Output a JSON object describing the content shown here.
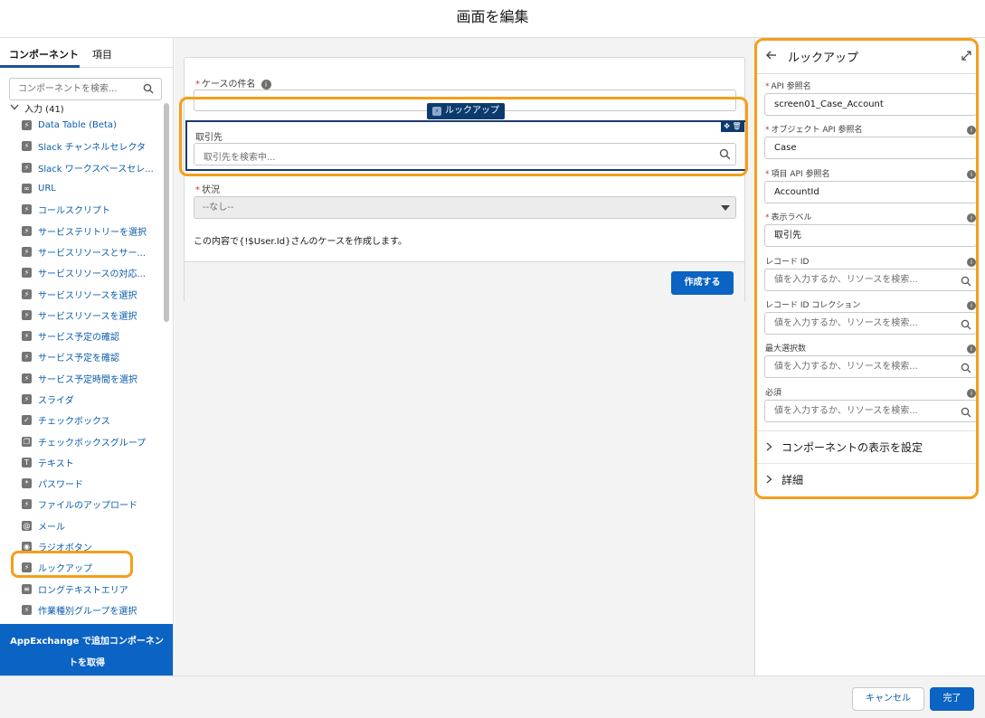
{
  "window": {
    "title": "画面を編集"
  },
  "left_panel": {
    "tabs": [
      {
        "label": "コンポーネント"
      },
      {
        "label": "項目"
      }
    ],
    "search_placeholder": "コンポーネントを検索...",
    "section_label": "入力 (41)",
    "components": [
      {
        "label": "Data Table (Beta)",
        "icon": "lightning-icon"
      },
      {
        "label": "Slack チャンネルセレクタ",
        "icon": "lightning-icon"
      },
      {
        "label": "Slack ワークスペースセレ...",
        "icon": "lightning-icon"
      },
      {
        "label": "URL",
        "icon": "link-icon"
      },
      {
        "label": "コールスクリプト",
        "icon": "lightning-icon"
      },
      {
        "label": "サービステリトリーを選択",
        "icon": "lightning-icon"
      },
      {
        "label": "サービスリソースとサー...",
        "icon": "lightning-icon"
      },
      {
        "label": "サービスリソースの対応...",
        "icon": "lightning-icon"
      },
      {
        "label": "サービスリソースを選択",
        "icon": "lightning-icon"
      },
      {
        "label": "サービスリソースを選択",
        "icon": "lightning-icon"
      },
      {
        "label": "サービス予定の確認",
        "icon": "lightning-icon"
      },
      {
        "label": "サービス予定を確認",
        "icon": "lightning-icon"
      },
      {
        "label": "サービス予定時間を選択",
        "icon": "lightning-icon"
      },
      {
        "label": "スライダ",
        "icon": "lightning-icon"
      },
      {
        "label": "チェックボックス",
        "icon": "checkbox-icon"
      },
      {
        "label": "チェックボックスグループ",
        "icon": "checkbox-group-icon"
      },
      {
        "label": "テキスト",
        "icon": "text-icon"
      },
      {
        "label": "パスワード",
        "icon": "password-icon"
      },
      {
        "label": "ファイルのアップロード",
        "icon": "lightning-icon"
      },
      {
        "label": "メール",
        "icon": "email-icon"
      },
      {
        "label": "ラジオボタン",
        "icon": "radio-icon"
      },
      {
        "label": "ルックアップ",
        "icon": "lightning-icon"
      },
      {
        "label": "ロングテキストエリア",
        "icon": "textarea-icon"
      },
      {
        "label": "作業種別グループを選択",
        "icon": "lightning-icon"
      }
    ],
    "appexchange_label": "AppExchange で追加コンポーネントを取得"
  },
  "canvas": {
    "subject_label": "ケースの件名",
    "lookup_tag": "ルックアップ",
    "lookup_label": "取引先",
    "lookup_placeholder": "取引先を検索中...",
    "status_label": "状況",
    "status_value": "--なし--",
    "body_text": "この内容で{!$User.Id}さんのケースを作成します。",
    "create_button": "作成する"
  },
  "right_panel": {
    "title": "ルックアップ",
    "fields": [
      {
        "label": "API 参照名",
        "value": "screen01_Case_Account",
        "required": true,
        "info": false
      },
      {
        "label": "オブジェクト API 参照名",
        "value": "Case",
        "required": true,
        "info": true
      },
      {
        "label": "項目 API 参照名",
        "value": "AccountId",
        "required": true,
        "info": true
      },
      {
        "label": "表示ラベル",
        "value": "取引先",
        "required": true,
        "info": true
      },
      {
        "label": "レコード ID",
        "placeholder": "値を入力するか、リソースを検索...",
        "required": false,
        "info": true
      },
      {
        "label": "レコード ID コレクション",
        "placeholder": "値を入力するか、リソースを検索...",
        "required": false,
        "info": true
      },
      {
        "label": "最大選択数",
        "placeholder": "値を入力するか、リソースを検索...",
        "required": false,
        "info": true
      },
      {
        "label": "必須",
        "placeholder": "値を入力するか、リソースを検索...",
        "required": false,
        "info": true
      }
    ],
    "sections": [
      {
        "label": "コンポーネントの表示を設定"
      },
      {
        "label": "詳細"
      }
    ]
  },
  "footer": {
    "cancel": "キャンセル",
    "done": "完了"
  },
  "colors": {
    "brand": "#0b63c4",
    "highlight": "#f59e1b",
    "link": "#0b5cab"
  }
}
